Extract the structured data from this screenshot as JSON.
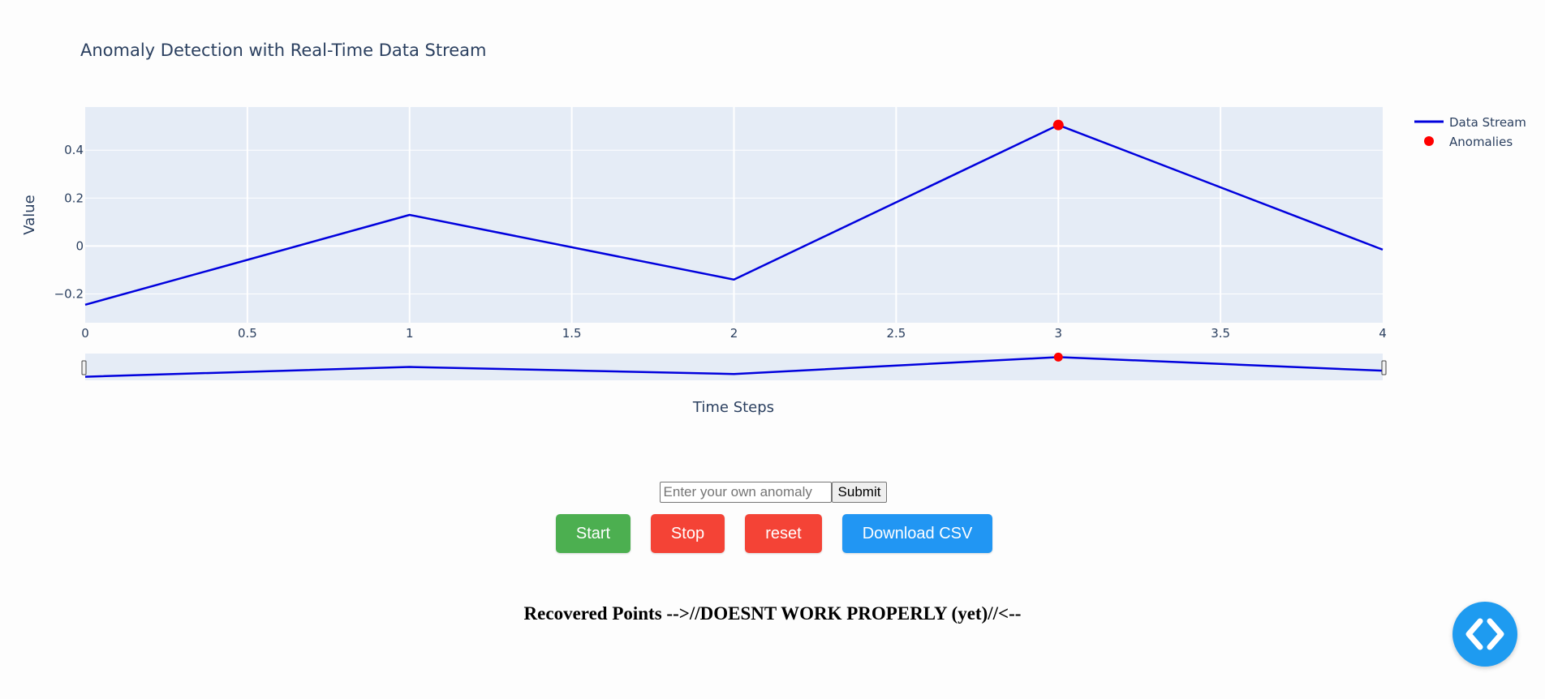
{
  "colors": {
    "line": "#0000dd",
    "anomaly": "#ff0000",
    "plot_bg": "#e5ecf6",
    "grid": "#ffffff",
    "start": "#4caf50",
    "stop": "#f44336",
    "reset": "#f44336",
    "download": "#2196f3",
    "fab": "#1e9bf0"
  },
  "chart_data": {
    "type": "line",
    "title": "Anomaly Detection with Real-Time Data Stream",
    "xlabel": "Time Steps",
    "ylabel": "Value",
    "xlim": [
      0,
      4
    ],
    "ylim": [
      -0.32,
      0.58
    ],
    "x_ticks": [
      "0",
      "0.5",
      "1",
      "1.5",
      "2",
      "2.5",
      "3",
      "3.5",
      "4"
    ],
    "x_tick_values": [
      0,
      0.5,
      1,
      1.5,
      2,
      2.5,
      3,
      3.5,
      4
    ],
    "y_ticks": [
      "−0.2",
      "0",
      "0.2",
      "0.4"
    ],
    "y_tick_values": [
      -0.2,
      0,
      0.2,
      0.4
    ],
    "grid": true,
    "legend_position": "top-right",
    "has_rangeslider": true,
    "series": [
      {
        "name": "Data Stream",
        "mode": "lines",
        "x": [
          0,
          1,
          2,
          3,
          4
        ],
        "y": [
          -0.245,
          0.13,
          -0.14,
          0.505,
          -0.015
        ]
      },
      {
        "name": "Anomalies",
        "mode": "markers",
        "x": [
          3
        ],
        "y": [
          0.505
        ]
      }
    ]
  },
  "form": {
    "placeholder": "Enter your own anomaly",
    "value": "",
    "submit_label": "Submit"
  },
  "buttons": {
    "start": "Start",
    "stop": "Stop",
    "reset": "reset",
    "download": "Download CSV"
  },
  "recovered_text": "Recovered Points -->//DOESNT WORK PROPERLY (yet)//<--",
  "fab_icon": "code-brackets-icon"
}
